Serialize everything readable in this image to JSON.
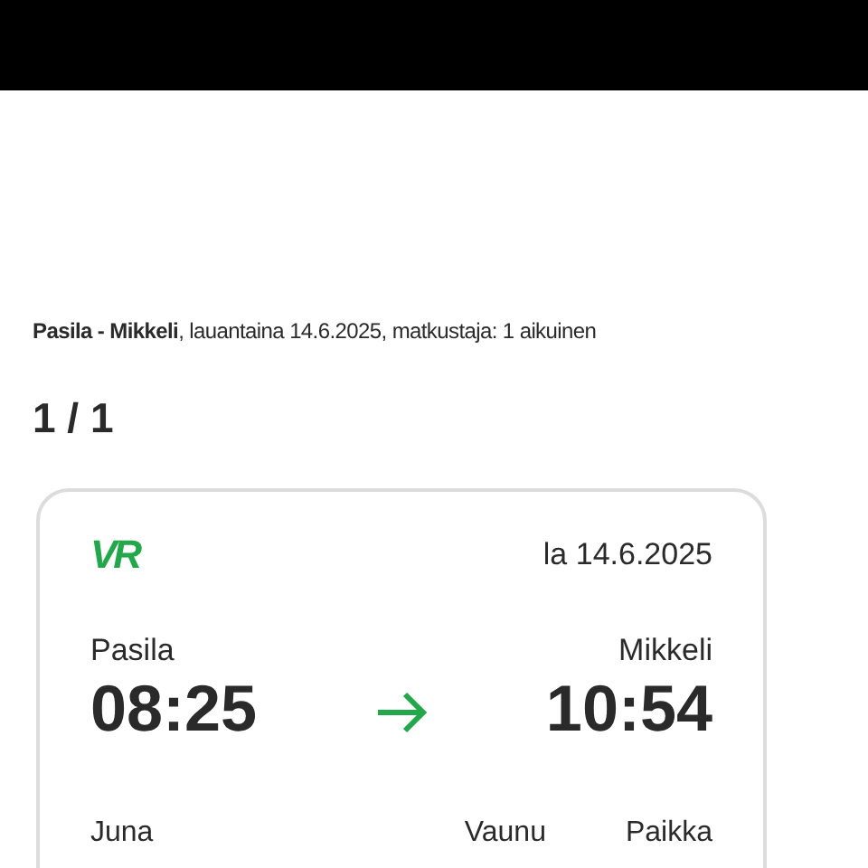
{
  "summary": "**Pasila - Mikkeli**, lauantaina 14.6.2025, matkustaja: 1 aikuinen",
  "counter": "1 / 1",
  "ticket": {
    "logo": "VR",
    "date": "la 14.6.2025",
    "departure": {
      "station": "Pasila",
      "time": "08:25"
    },
    "arrival": {
      "station": "Mikkeli",
      "time": "10:54"
    },
    "labels": [
      "Juna",
      "Vaunu",
      "Paikka"
    ]
  }
}
